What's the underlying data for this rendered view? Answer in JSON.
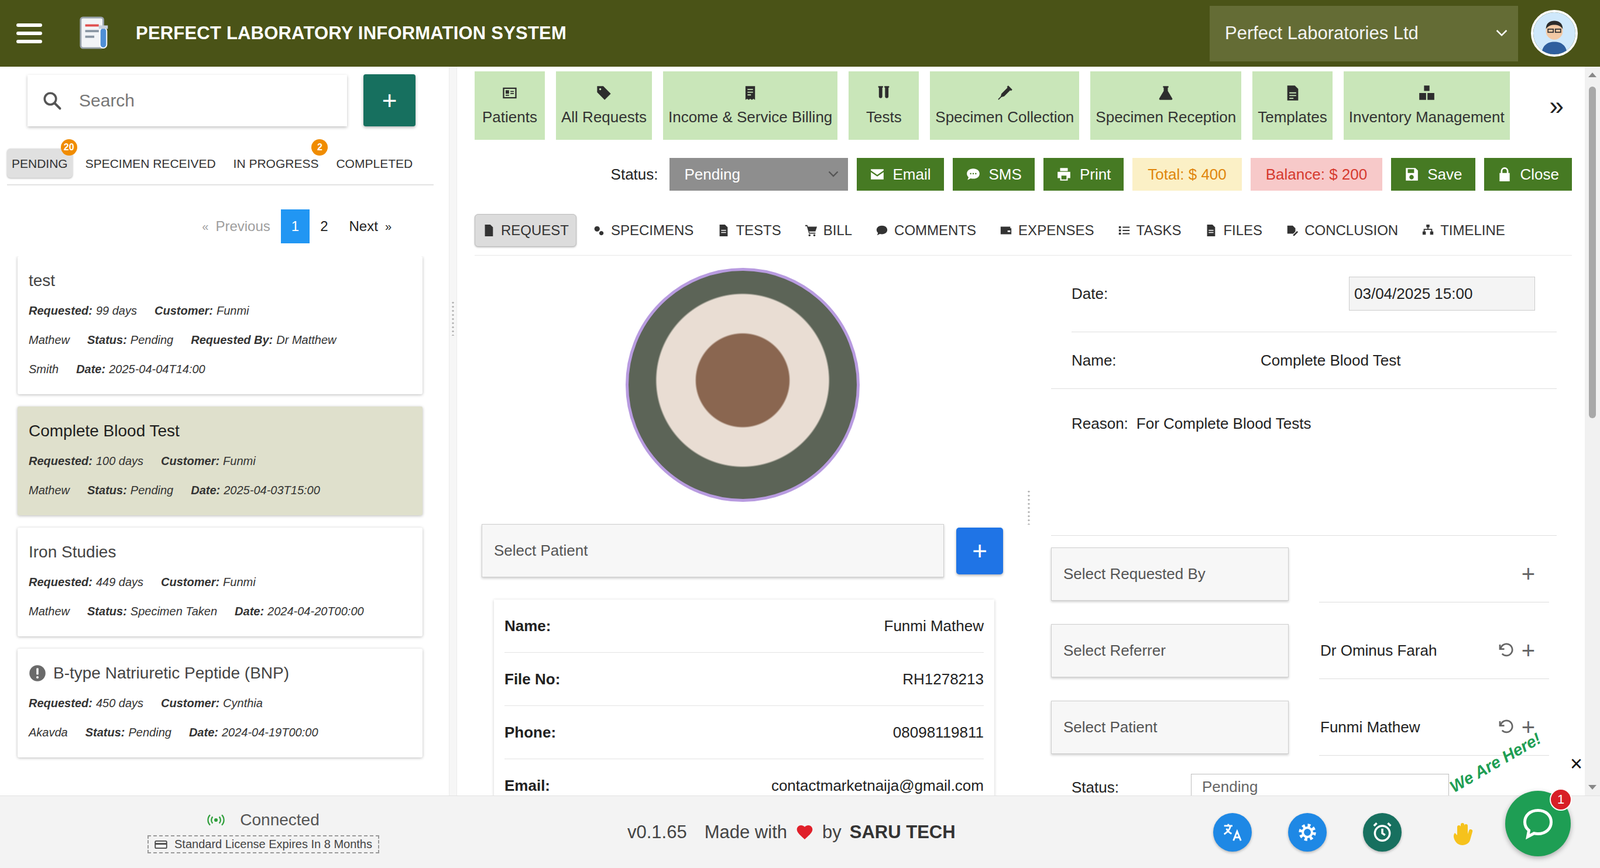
{
  "header": {
    "title": "PERFECT LABORATORY INFORMATION SYSTEM",
    "organization": "Perfect Laboratories Ltd"
  },
  "sidebar": {
    "search_placeholder": "Search",
    "add_button": "+",
    "tabs": [
      {
        "label": "PENDING",
        "badge": "20",
        "selected": true
      },
      {
        "label": "SPECIMEN RECEIVED",
        "badge": "",
        "selected": false
      },
      {
        "label": "IN PROGRESS",
        "badge": "2",
        "selected": false
      },
      {
        "label": "COMPLETED",
        "badge": "",
        "selected": false
      }
    ],
    "pagination": {
      "previous_icon": "«",
      "previous": "Previous",
      "previous_disabled": true,
      "pages": [
        {
          "label": "1",
          "selected": true
        },
        {
          "label": "2",
          "selected": false
        }
      ],
      "next": "Next",
      "next_icon": "»"
    },
    "requests": [
      {
        "title": "test",
        "flagged": false,
        "selected": false,
        "fields": [
          {
            "label": "Requested:",
            "value": "99 days"
          },
          {
            "label": "Customer:",
            "value": "Funmi Mathew"
          },
          {
            "label": "Status:",
            "value": "Pending"
          },
          {
            "label": "Requested By:",
            "value": "Dr Matthew Smith"
          },
          {
            "label": "Date:",
            "value": "2025-04-04T14:00"
          }
        ]
      },
      {
        "title": "Complete Blood Test",
        "flagged": false,
        "selected": true,
        "fields": [
          {
            "label": "Requested:",
            "value": "100 days"
          },
          {
            "label": "Customer:",
            "value": "Funmi Mathew"
          },
          {
            "label": "Status:",
            "value": "Pending"
          },
          {
            "label": "Date:",
            "value": "2025-04-03T15:00"
          }
        ]
      },
      {
        "title": "Iron Studies",
        "flagged": false,
        "selected": false,
        "fields": [
          {
            "label": "Requested:",
            "value": "449 days"
          },
          {
            "label": "Customer:",
            "value": "Funmi Mathew"
          },
          {
            "label": "Status:",
            "value": "Specimen Taken"
          },
          {
            "label": "Date:",
            "value": "2024-04-20T00:00"
          }
        ]
      },
      {
        "title": "B-type Natriuretic Peptide (BNP)",
        "flagged": true,
        "selected": false,
        "fields": [
          {
            "label": "Requested:",
            "value": "450 days"
          },
          {
            "label": "Customer:",
            "value": "Cynthia Akavda"
          },
          {
            "label": "Status:",
            "value": "Pending"
          },
          {
            "label": "Date:",
            "value": "2024-04-19T00:00"
          }
        ]
      }
    ]
  },
  "toolbar": {
    "items": [
      {
        "label": "Patients"
      },
      {
        "label": "All Requests"
      },
      {
        "label": "Income & Service Billing"
      },
      {
        "label": "Tests"
      },
      {
        "label": "Specimen Collection"
      },
      {
        "label": "Specimen Reception"
      },
      {
        "label": "Templates"
      },
      {
        "label": "Inventory Management"
      }
    ],
    "more": "»"
  },
  "actions": {
    "status_label": "Status:",
    "status_value": "Pending",
    "buttons": [
      {
        "label": "Email"
      },
      {
        "label": "SMS"
      },
      {
        "label": "Print"
      }
    ],
    "total": "Total: $ 400",
    "balance": "Balance: $ 200",
    "save": "Save",
    "close": "Close"
  },
  "request_tabs": [
    {
      "label": "REQUEST",
      "selected": true
    },
    {
      "label": "SPECIMENS",
      "selected": false
    },
    {
      "label": "TESTS",
      "selected": false
    },
    {
      "label": "BILL",
      "selected": false
    },
    {
      "label": "COMMENTS",
      "selected": false
    },
    {
      "label": "EXPENSES",
      "selected": false
    },
    {
      "label": "TASKS",
      "selected": false
    },
    {
      "label": "FILES",
      "selected": false
    },
    {
      "label": "CONCLUSION",
      "selected": false
    },
    {
      "label": "TIMELINE",
      "selected": false
    }
  ],
  "patient": {
    "select_placeholder": "Select Patient",
    "add_button": "+",
    "fields": [
      {
        "label": "Name:",
        "value": "Funmi Mathew"
      },
      {
        "label": "File No:",
        "value": "RH1278213"
      },
      {
        "label": "Phone:",
        "value": "08098119811"
      },
      {
        "label": "Email:",
        "value": "contactmarketnaija@gmail.com"
      }
    ]
  },
  "request_form": {
    "date_label": "Date:",
    "date_value": "03/04/2025 15:00",
    "name_label": "Name:",
    "name_value": "Complete Blood Test",
    "reason_label": "Reason:",
    "reason_value": "For Complete Blood Tests",
    "selects": [
      {
        "placeholder": "Select Requested By",
        "value": "",
        "resettable": false,
        "add": "+"
      },
      {
        "placeholder": "Select Referrer",
        "value": "Dr Ominus Farah",
        "resettable": true,
        "add": "+"
      },
      {
        "placeholder": "Select Patient",
        "value": "Funmi Mathew",
        "resettable": true,
        "add": "+"
      }
    ],
    "status_label": "Status:",
    "status_value": "Pending"
  },
  "chat": {
    "label": "We Are Here!",
    "badge": "1",
    "close": "×"
  },
  "footer": {
    "connection": "Connected",
    "license": "Standard License Expires In 8 Months",
    "version": "v0.1.65",
    "made_with": "Made with",
    "by": "by",
    "brand": "SARU TECH"
  }
}
